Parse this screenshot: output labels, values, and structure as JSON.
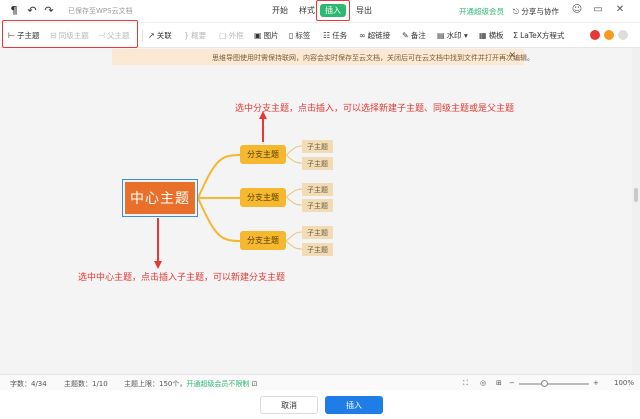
{
  "topbar": {
    "status": "已保存至WPS云文档",
    "tabs": [
      "开始",
      "样式",
      "插入",
      "导出"
    ],
    "active_tab": "插入",
    "member_link": "开通超级会员",
    "share": "分享与协作"
  },
  "toolbar": {
    "child_topic": "子主题",
    "sibling_topic": "同级主题",
    "parent_topic": "父主题",
    "relation": "关联",
    "summary": "概要",
    "outline": "外框",
    "image": "图片",
    "tag": "标签",
    "task": "任务",
    "hyperlink": "超链接",
    "note": "备注",
    "watermark": "水印",
    "template": "横板",
    "latex": "LaTeX方程式"
  },
  "notice": {
    "text": "思维导图使用时需保持联网，内容会实时保存至云文档，关闭后可在云文档中找到文件并打开再次编辑。"
  },
  "mindmap": {
    "central": "中心主题",
    "branches": [
      {
        "label": "分支主题",
        "children": [
          "子主题",
          "子主题"
        ]
      },
      {
        "label": "分支主题",
        "children": [
          "子主题",
          "子主题"
        ]
      },
      {
        "label": "分支主题",
        "children": [
          "子主题",
          "子主题"
        ]
      }
    ],
    "annotation_top": "选中分支主题，点击插入，可以选择新建子主题、同级主题或是父主题",
    "annotation_bottom": "选中中心主题，点击插入子主题，可以新建分支主题"
  },
  "statusbar": {
    "word_count": "字数：4/34",
    "topic_count": "主题数：1/10",
    "topic_limit": "主题上限：150个，",
    "upgrade_link": "开通超级会员不限制",
    "zoom": "100%"
  },
  "buttons": {
    "cancel": "取消",
    "insert": "插入"
  },
  "colors": {
    "accent": "#2eb872",
    "primary_button": "#1f7de8",
    "central_topic": "#e8702a",
    "branch_topic": "#f5b82e",
    "sub_topic": "#f1dcb6",
    "annotation": "#e53935"
  }
}
